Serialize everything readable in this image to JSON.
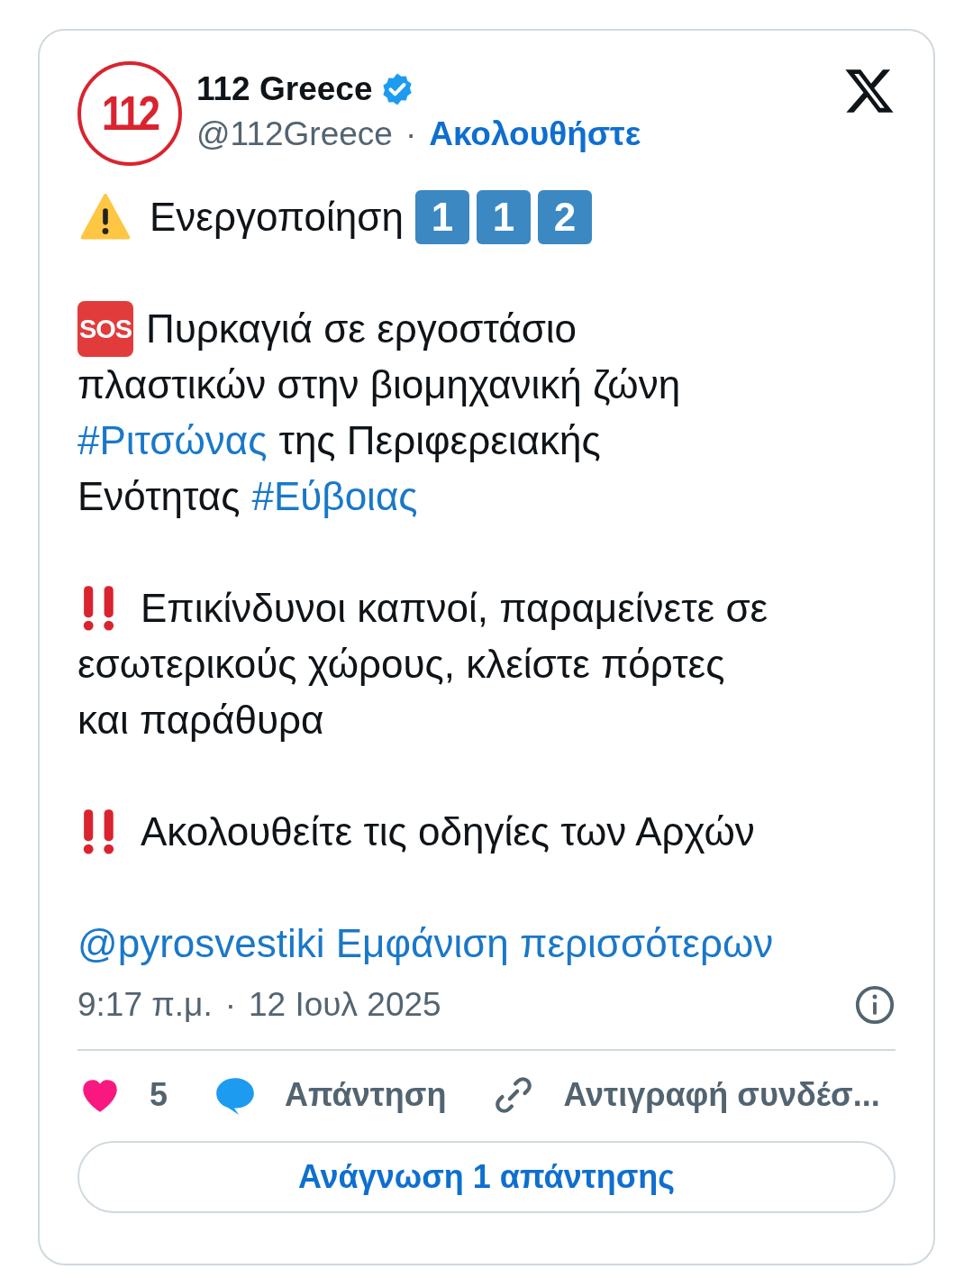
{
  "author": {
    "logo_text": "112",
    "name": "112 Greece",
    "verified": true,
    "handle": "@112Greece",
    "separator": "·",
    "follow": "Ακολουθήστε"
  },
  "body": [
    {
      "kind": "alert",
      "lines": [
        [
          {
            "kind": "text",
            "text": "Ενεργοποίηση"
          },
          {
            "kind": "keycap",
            "text": "1"
          },
          {
            "kind": "keycap",
            "text": "1"
          },
          {
            "kind": "keycap",
            "text": "2"
          }
        ]
      ]
    },
    {
      "kind": "sos",
      "icon_text": "SOS",
      "lines": [
        [
          {
            "kind": "text",
            "text": "Πυρκαγιά σε εργοστάσιο"
          }
        ],
        [
          {
            "kind": "text",
            "text": "πλαστικών στην βιομηχανική ζώνη"
          }
        ],
        [
          {
            "kind": "hashtag",
            "text": "#Ριτσώνας"
          },
          {
            "kind": "text",
            "text": "της Περιφερειακής"
          }
        ],
        [
          {
            "kind": "text",
            "text": "Ενότητας"
          },
          {
            "kind": "hashtag",
            "text": "#Εύβοιας"
          }
        ]
      ]
    },
    {
      "kind": "urgent",
      "lines": [
        [
          {
            "kind": "text",
            "text": "Επικίνδυνοι καπνοί, παραμείνετε σε"
          }
        ],
        [
          {
            "kind": "text",
            "text": "εσωτερικούς χώρους, κλείστε πόρτες"
          }
        ],
        [
          {
            "kind": "text",
            "text": "και παράθυρα"
          }
        ]
      ]
    },
    {
      "kind": "urgent",
      "lines": [
        [
          {
            "kind": "text",
            "text": "Ακολουθείτε τις οδηγίες των Αρχών"
          }
        ]
      ]
    }
  ],
  "more": {
    "mention": "@pyrosvestiki",
    "show_more": "Εμφάνιση περισσότερων"
  },
  "meta": {
    "time": "9:17 π.μ.",
    "separator": "·",
    "date": "12 Ιουλ 2025"
  },
  "actions": [
    {
      "kind": "like",
      "label": "5"
    },
    {
      "kind": "reply",
      "label": "Απάντηση"
    },
    {
      "kind": "copy",
      "label": "Αντιγραφή συνδέσ..."
    }
  ],
  "read_replies": "Ανάγνωση 1 απάντησης"
}
